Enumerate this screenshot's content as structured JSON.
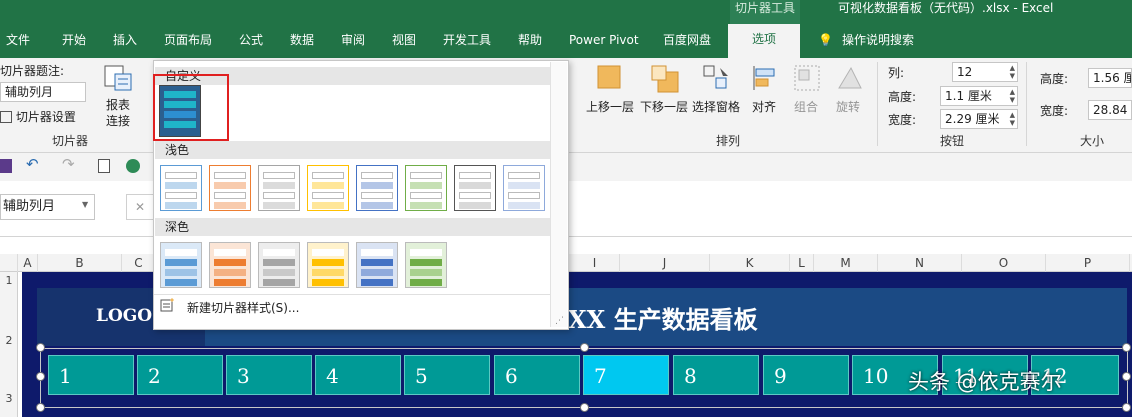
{
  "title": {
    "context_tool": "切片器工具",
    "document": "可视化数据看板（无代码）.xlsx  -  Excel"
  },
  "tabs": [
    "文件",
    "开始",
    "插入",
    "页面布局",
    "公式",
    "数据",
    "审阅",
    "视图",
    "开发工具",
    "帮助",
    "Power Pivot",
    "百度网盘"
  ],
  "active_tab": "选项",
  "tell_me": "操作说明搜索",
  "ribbon": {
    "caption_label": "切片器题注:",
    "caption_value": "辅助列月",
    "slicer_settings": "切片器设置",
    "group_slicer": "切片器",
    "report_conn_1": "报表",
    "report_conn_2": "连接",
    "bring_forward": "上移一层",
    "send_backward": "下移一层",
    "selection_pane": "选择窗格",
    "align": "对齐",
    "group": "组合",
    "rotate": "旋转",
    "group_arrange": "排列",
    "columns_label": "列:",
    "columns_value": "12",
    "btn_height_label": "高度:",
    "btn_height_value": "1.1 厘米",
    "btn_width_label": "宽度:",
    "btn_width_value": "2.29 厘米",
    "group_buttons": "按钮",
    "size_height_label": "高度:",
    "size_height_value": "1.56 厘",
    "size_width_label": "宽度:",
    "size_width_value": "28.84 厘",
    "group_size": "大小"
  },
  "formula_bar": {
    "name_box": "辅助列月",
    "cancel_icon": "✕"
  },
  "gallery": {
    "custom": "自定义",
    "light": "浅色",
    "dark": "深色",
    "new_style": "新建切片器样式(S)..."
  },
  "columns": [
    "A",
    "B",
    "C",
    "I",
    "J",
    "K",
    "L",
    "M",
    "N",
    "O",
    "P"
  ],
  "rows": [
    "1",
    "2",
    "3"
  ],
  "dashboard": {
    "logo": "LOGO",
    "title": "XX 生产数据看板"
  },
  "slicer": {
    "items": [
      "1",
      "2",
      "3",
      "4",
      "5",
      "6",
      "7",
      "8",
      "9",
      "10",
      "11",
      "12"
    ],
    "selected": "7"
  },
  "watermark": "头条 @依克赛尔",
  "colors": {
    "excel_green": "#217346",
    "dashboard_bg": "#0e1a6b",
    "slicer_button": "#009a96",
    "slicer_selected": "#00c8f0",
    "highlight_box": "#e02020"
  },
  "icons": {
    "report_connection": "report-connection-icon",
    "bring_forward": "bring-forward-icon",
    "send_backward": "send-backward-icon",
    "selection_pane": "selection-pane-icon",
    "align": "align-icon",
    "group": "group-icon",
    "rotate": "rotate-icon",
    "save": "save-icon",
    "undo": "undo-icon",
    "redo": "redo-icon",
    "lightbulb": "lightbulb-icon"
  }
}
